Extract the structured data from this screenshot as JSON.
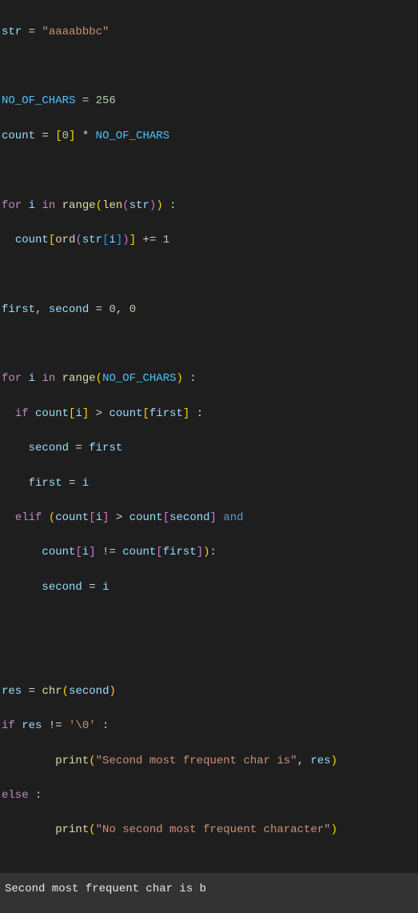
{
  "code": {
    "l1_var": "str",
    "l1_val": "\"aaaabbbc\"",
    "l3_var": "NO_OF_CHARS",
    "l3_val": "256",
    "l4_var": "count",
    "l4_lb": "[",
    "l4_zero": "0",
    "l4_rb": "]",
    "l4_mul": " * ",
    "l4_ref": "NO_OF_CHARS",
    "l6_for": "for",
    "l6_i": "i",
    "l6_in": "in",
    "l6_range": "range",
    "l6_len": "len",
    "l6_str": "str",
    "l7_count": "count",
    "l7_ord": "ord",
    "l7_str": "str",
    "l7_i": "i",
    "l7_inc": " += ",
    "l7_one": "1",
    "l9_first": "first",
    "l9_second": "second",
    "l9_z1": "0",
    "l9_z2": "0",
    "l11_for": "for",
    "l11_i": "i",
    "l11_in": "in",
    "l11_range": "range",
    "l11_noc": "NO_OF_CHARS",
    "l12_if": "if",
    "l12_count1": "count",
    "l12_i1": "i",
    "l12_gt": " > ",
    "l12_count2": "count",
    "l12_first": "first",
    "l13_second": "second",
    "l13_first": "first",
    "l14_first": "first",
    "l14_i": "i",
    "l15_elif": "elif",
    "l15_count1": "count",
    "l15_i1": "i",
    "l15_gt": " > ",
    "l15_count2": "count",
    "l15_second": "second",
    "l15_and": "and",
    "l16_count1": "count",
    "l16_i1": "i",
    "l16_ne": " != ",
    "l16_count2": "count",
    "l16_first": "first",
    "l17_second": "second",
    "l17_i": "i",
    "l20_res": "res",
    "l20_chr": "chr",
    "l20_second": "second",
    "l21_if": "if",
    "l21_res": "res",
    "l21_ne": " != ",
    "l21_val": "'\\0'",
    "l22_print": "print",
    "l22_str": "\"Second most frequent char is\"",
    "l22_res": "res",
    "l23_else": "else",
    "l24_print": "print",
    "l24_str": "\"No second most frequent character\""
  },
  "output": {
    "text": "Second most frequent char is b"
  }
}
